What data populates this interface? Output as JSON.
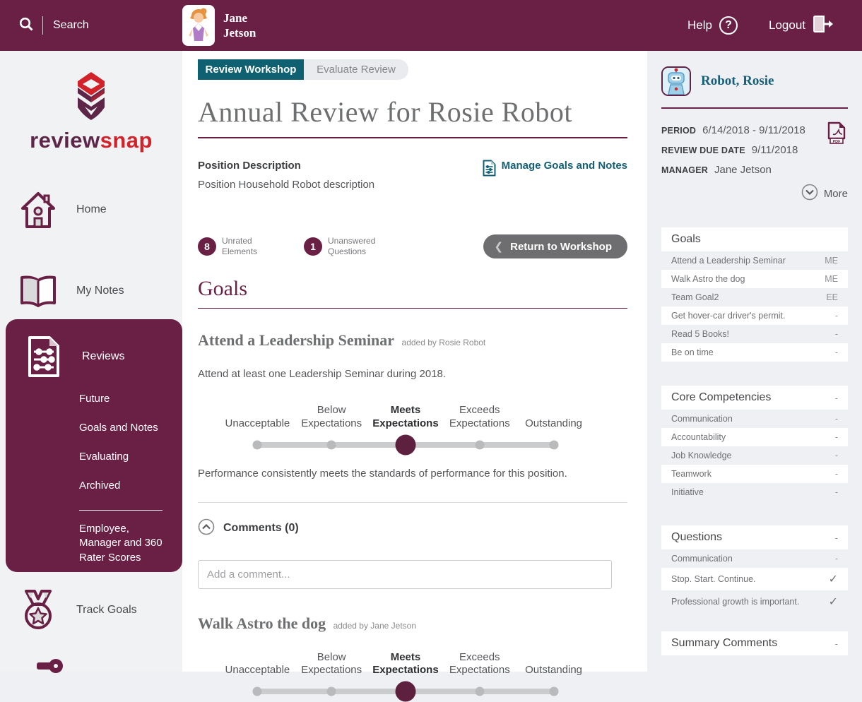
{
  "colors": {
    "accent_maroon": "#6a2044",
    "accent_red": "#d2232a",
    "accent_teal": "#0f6070",
    "link_teal": "#136076",
    "selected_dot": "#5e203f"
  },
  "header": {
    "search_label": "Search",
    "user": {
      "first": "Jane",
      "last": "Jetson"
    },
    "help_label": "Help",
    "logout_label": "Logout"
  },
  "brand": {
    "left": "review",
    "right": "snap"
  },
  "nav": {
    "home": "Home",
    "my_notes": "My Notes",
    "reviews": "Reviews",
    "reviews_sub": [
      "Future",
      "Goals and Notes",
      "Evaluating",
      "Archived"
    ],
    "reviews_scores": "Employee, Manager and 360 Rater Scores",
    "track_goals": "Track Goals"
  },
  "main": {
    "tabs": [
      {
        "label": "Review Workshop",
        "active": true
      },
      {
        "label": "Evaluate Review",
        "active": false
      }
    ],
    "title": "Annual Review for Rosie Robot",
    "position": {
      "label": "Position Description",
      "value": "Position Household Robot description"
    },
    "manage_link": "Manage Goals and Notes",
    "badges": [
      {
        "count": "8",
        "label": "Unrated Elements"
      },
      {
        "count": "1",
        "label": "Unanswered Questions"
      }
    ],
    "return_button": "Return to Workshop",
    "section_title": "Goals",
    "scale": {
      "labels": [
        "Unacceptable",
        "Below Expectations",
        "Meets Expectations",
        "Exceeds Expectations",
        "Outstanding"
      ],
      "selected_index": 2
    },
    "goals": [
      {
        "title": "Attend a Leadership Seminar",
        "added_by": "added by Rosie Robot",
        "description": "Attend at least one Leadership Seminar during 2018.",
        "rating_text": "Performance consistently meets the standards of performance for this position.",
        "comments_label": "Comments (0)",
        "comment_placeholder": "Add a comment..."
      },
      {
        "title": "Walk Astro the dog",
        "added_by": "added by Jane Jetson"
      }
    ]
  },
  "right": {
    "profile": {
      "name": "Robot, Rosie"
    },
    "meta": [
      {
        "label": "PERIOD",
        "value": "6/14/2018 - 9/11/2018"
      },
      {
        "label": "REVIEW DUE DATE",
        "value": "9/11/2018"
      },
      {
        "label": "MANAGER",
        "value": "Jane Jetson"
      }
    ],
    "more_label": "More",
    "panels": {
      "goals": {
        "title": "Goals",
        "header_value": "",
        "rows": [
          {
            "label": "Attend a Leadership Seminar",
            "value": "ME"
          },
          {
            "label": "Walk Astro the dog",
            "value": "ME"
          },
          {
            "label": "Team Goal2",
            "value": "EE"
          },
          {
            "label": "Get hover-car driver's permit.",
            "value": "-"
          },
          {
            "label": "Read 5 Books!",
            "value": "-"
          },
          {
            "label": "Be on time",
            "value": "-"
          }
        ]
      },
      "core": {
        "title": "Core Competencies",
        "header_value": "-",
        "rows": [
          {
            "label": "Communication",
            "value": "-"
          },
          {
            "label": "Accountability",
            "value": "-"
          },
          {
            "label": "Job Knowledge",
            "value": "-"
          },
          {
            "label": "Teamwork",
            "value": "-"
          },
          {
            "label": "Initiative",
            "value": "-"
          }
        ]
      },
      "questions": {
        "title": "Questions",
        "header_value": "-",
        "rows": [
          {
            "label": "Communication",
            "value": "-"
          },
          {
            "label": "Stop. Start. Continue.",
            "value": "✓"
          },
          {
            "label": "Professional growth is important.",
            "value": "✓"
          }
        ]
      },
      "summary": {
        "title": "Summary Comments",
        "header_value": "-"
      }
    }
  }
}
